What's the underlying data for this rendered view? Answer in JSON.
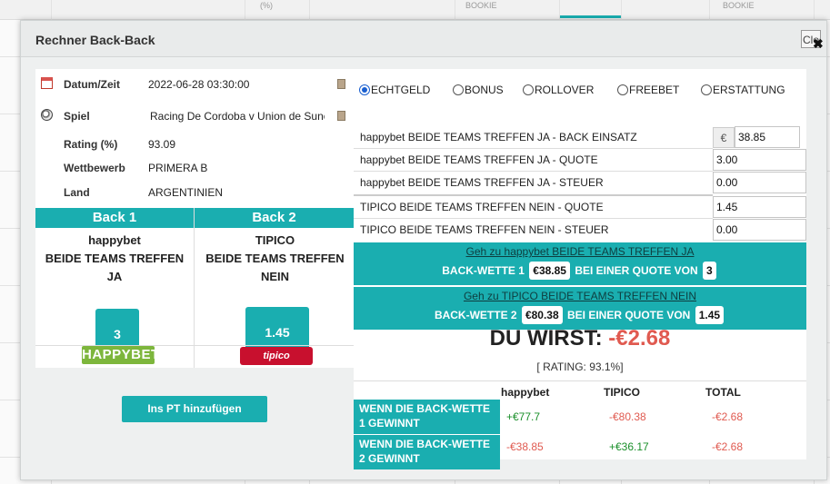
{
  "background": {
    "header_fragments": [
      "(%)",
      "BOOKIE",
      "BOOKIE"
    ]
  },
  "modal": {
    "title": "Rechner Back-Back",
    "close_label": "Close"
  },
  "info": {
    "date_label": "Datum/Zeit",
    "date_value": "2022-06-28 03:30:00",
    "game_label": "Spiel",
    "game_value": "Racing De Cordoba v Union de Sunchales",
    "rating_label": "Rating (%)",
    "rating_value": "93.09",
    "competition_label": "Wettbewerb",
    "competition_value": "PRIMERA B",
    "country_label": "Land",
    "country_value": "ARGENTINIEN"
  },
  "backs": {
    "back1_title": "Back 1",
    "back1_bookie": "happybet",
    "back1_market": "BEIDE TEAMS TREFFEN JA",
    "back1_odds": "3",
    "back1_logo": "HAPPYBET",
    "back2_title": "Back 2",
    "back2_bookie": "TIPICO",
    "back2_market": "BEIDE TEAMS TREFFEN NEIN",
    "back2_odds": "1.45",
    "back2_logo": "tipico"
  },
  "add_pt_label": "Ins PT hinzufügen",
  "bet_types": [
    {
      "label": "ECHTGELD",
      "checked": true
    },
    {
      "label": "BONUS",
      "checked": false
    },
    {
      "label": "ROLLOVER",
      "checked": false
    },
    {
      "label": "FREEBET",
      "checked": false
    },
    {
      "label": "ERSTATTUNG",
      "checked": false
    }
  ],
  "fields": {
    "back1_stake_label": "happybet BEIDE TEAMS TREFFEN JA - BACK EINSATZ",
    "currency_symbol": "€",
    "back1_stake_value": "38.85",
    "back1_odds_label": "happybet BEIDE TEAMS TREFFEN JA - QUOTE",
    "back1_odds_value": "3.00",
    "back1_tax_label": "happybet BEIDE TEAMS TREFFEN JA - STEUER",
    "back1_tax_value": "0.00",
    "back2_odds_label": "TIPICO BEIDE TEAMS TREFFEN NEIN  - QUOTE",
    "back2_odds_value": "1.45",
    "back2_tax_label": "TIPICO BEIDE TEAMS TREFFEN NEIN - STEUER",
    "back2_tax_value": "0.00"
  },
  "instructions": {
    "link1": "Geh zu happybet BEIDE TEAMS TREFFEN JA",
    "line1_prefix": "BACK-WETTE 1",
    "line1_stake": "€38.85",
    "line1_mid": "BEI EINER QUOTE VON",
    "line1_odds": "3",
    "link2": "Geh zu TIPICO BEIDE TEAMS TREFFEN NEIN",
    "line2_prefix": "BACK-WETTE 2",
    "line2_stake": "€80.38",
    "line2_mid": "BEI EINER QUOTE VON",
    "line2_odds": "1.45"
  },
  "result": {
    "label": "DU WIRST:",
    "amount": "-€2.68",
    "rating": "[ RATING: 93.1%]"
  },
  "results_table": {
    "headers": [
      "happybet",
      "TIPICO",
      "TOTAL"
    ],
    "rows": [
      {
        "label": "WENN DIE BACK-WETTE 1 GEWINNT",
        "values": [
          "+€77.7",
          "-€80.38",
          "-€2.68"
        ]
      },
      {
        "label": "WENN DIE BACK-WETTE 2 GEWINNT",
        "values": [
          "-€38.85",
          "+€36.17",
          "-€2.68"
        ]
      }
    ]
  },
  "colors": {
    "accent": "#1aaeb0",
    "positive": "#1a8f2a",
    "negative": "#e05a50"
  }
}
